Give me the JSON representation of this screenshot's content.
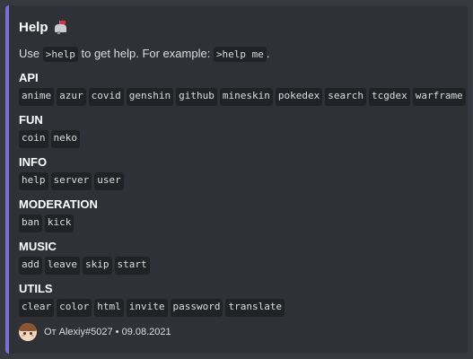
{
  "embed": {
    "accent_color": "#7b6fd6",
    "title": "Help",
    "title_icon": "mailbox-icon",
    "description": {
      "prefix": "Use",
      "command": ">help",
      "middle": "to get help. For example:",
      "example": ">help me",
      "suffix": "."
    },
    "fields": [
      {
        "name": "API",
        "values": [
          "anime",
          "azur",
          "covid",
          "genshin",
          "github",
          "mineskin",
          "pokedex",
          "search",
          "tcgdex",
          "warframe"
        ]
      },
      {
        "name": "FUN",
        "values": [
          "coin",
          "neko"
        ]
      },
      {
        "name": "INFO",
        "values": [
          "help",
          "server",
          "user"
        ]
      },
      {
        "name": "MODERATION",
        "values": [
          "ban",
          "kick"
        ]
      },
      {
        "name": "MUSIC",
        "values": [
          "add",
          "leave",
          "skip",
          "start"
        ]
      },
      {
        "name": "UTILS",
        "values": [
          "clear",
          "color",
          "html",
          "invite",
          "password",
          "translate"
        ]
      }
    ],
    "footer": {
      "text": "От Alexiy#5027",
      "separator": "•",
      "date": "09.08.2021",
      "icon": "avatar"
    }
  }
}
